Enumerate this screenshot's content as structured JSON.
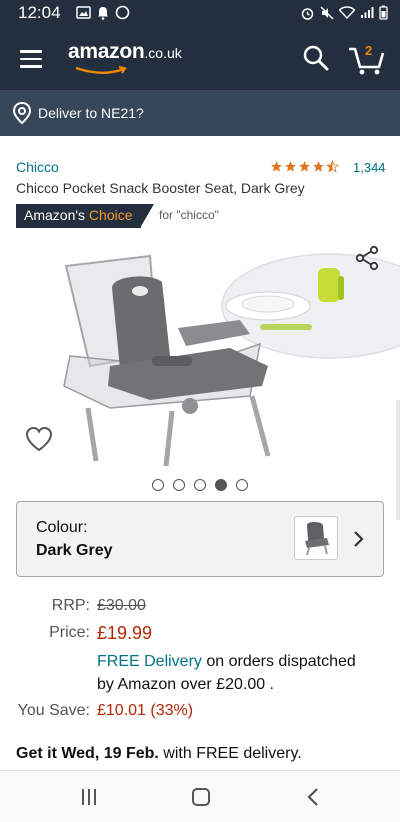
{
  "status_bar": {
    "time": "12:04"
  },
  "header": {
    "logo_main": "amazon",
    "logo_tld": ".co.uk",
    "cart_count": "2"
  },
  "deliver": {
    "text": "Deliver to NE21?"
  },
  "product": {
    "brand": "Chicco",
    "rating_stars": 4.5,
    "review_count": "1,344",
    "title": "Chicco Pocket Snack Booster Seat, Dark Grey",
    "badge_prefix": "Amazon's",
    "badge_choice": "Choice",
    "badge_for": "for \"chicco\""
  },
  "gallery": {
    "count": 5,
    "active_index": 3
  },
  "colour": {
    "label": "Colour:",
    "value": "Dark Grey"
  },
  "pricing": {
    "rrp_label": "RRP:",
    "rrp_value": "£30.00",
    "price_label": "Price:",
    "price_value": "£19.99",
    "free_delivery_link": "FREE Delivery",
    "delivery_line1_rest": "on orders dispatched",
    "delivery_line2": "by Amazon over £20.00 .",
    "save_label": "You Save:",
    "save_value": "£10.01 (33%)"
  },
  "delivery_estimate": {
    "prefix": "Get it Wed, 19 Feb.",
    "suffix": "with FREE delivery."
  },
  "colors": {
    "header_bg": "#232f3e",
    "deliver_bg": "#37475a",
    "link": "#007185",
    "price": "#b12704",
    "choice_accent": "#f69931"
  }
}
